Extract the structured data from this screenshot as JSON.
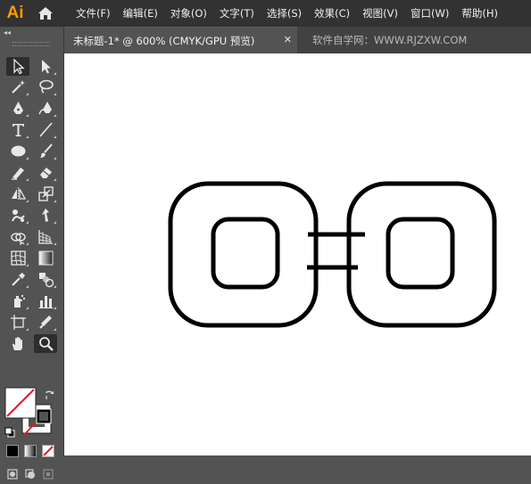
{
  "app": {
    "logo": "Ai"
  },
  "menu": [
    "文件(F)",
    "编辑(E)",
    "对象(O)",
    "文字(T)",
    "选择(S)",
    "效果(C)",
    "视图(V)",
    "窗口(W)",
    "帮助(H)"
  ],
  "tab": {
    "title": "未标题-1* @ 600% (CMYK/GPU 预览)",
    "close": "✕"
  },
  "watermark": "软件自学网：WWW.RJZXW.COM",
  "toolbar": {
    "collapse": "◂◂"
  },
  "colors": {
    "logo": "#ff9a00",
    "menubar": "#323232",
    "panel": "#535353",
    "canvas": "#ffffff",
    "none_swatch_slash": "#e31b23",
    "artwork_stroke": "#000000"
  },
  "tools": [
    "selection-tool",
    "direct-selection-tool",
    "magic-wand-tool",
    "lasso-tool",
    "pen-tool",
    "curvature-tool",
    "type-tool",
    "line-segment-tool",
    "ellipse-tool",
    "paintbrush-tool",
    "shaper-tool",
    "eraser-tool",
    "reflect-tool",
    "scale-tool",
    "puppet-warp-tool",
    "free-transform-tool",
    "shape-builder-tool",
    "perspective-grid-tool",
    "mesh-tool",
    "gradient-tool",
    "eyedropper-tool",
    "blend-tool",
    "symbol-sprayer-tool",
    "column-graph-tool",
    "artboard-tool",
    "slice-tool",
    "hand-tool",
    "zoom-tool"
  ]
}
